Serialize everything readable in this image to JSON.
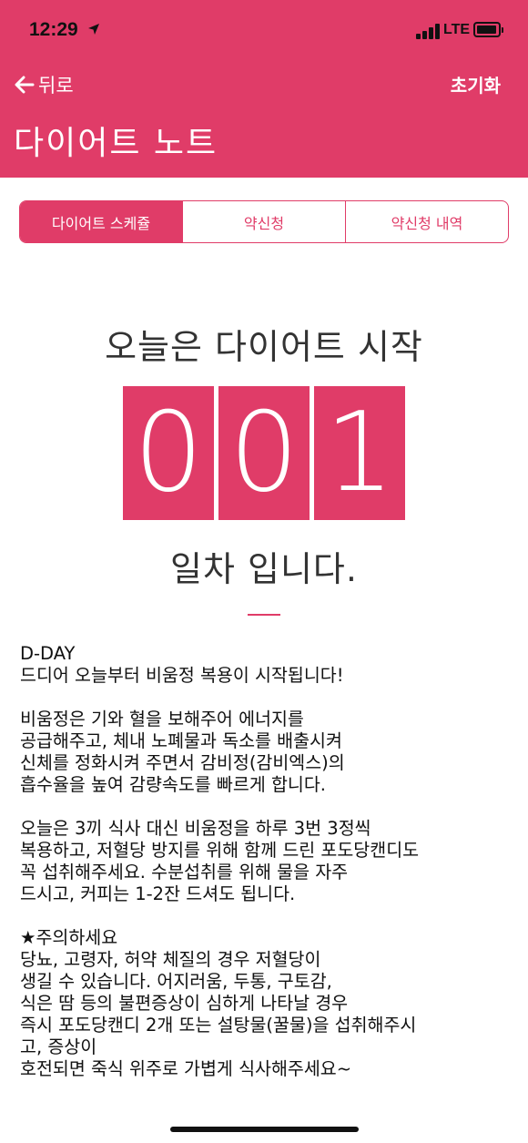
{
  "status_bar": {
    "time": "12:29",
    "network": "LTE",
    "icons": [
      "location-arrow-icon",
      "signal-bars-icon",
      "battery-icon"
    ]
  },
  "header": {
    "back_label": "뒤로",
    "reset_label": "초기화",
    "title": "다이어트 노트",
    "background_color": "#e03c68"
  },
  "tabs": [
    {
      "label": "다이어트 스케쥴",
      "active": true
    },
    {
      "label": "약신청",
      "active": false
    },
    {
      "label": "약신청 내역",
      "active": false
    }
  ],
  "main": {
    "headline": "오늘은 다이어트 시작",
    "day_digits": [
      "0",
      "0",
      "1"
    ],
    "subline": "일차 입니다."
  },
  "notes": {
    "day_title": "D-DAY",
    "intro": "드디어 오늘부터 비움정 복용이 시작됩니다!",
    "paragraph1": "비움정은 기와 혈을 보해주어 에너지를\n공급해주고, 체내 노폐물과 독소를 배출시켜\n신체를 정화시켜 주면서 감비정(감비엑스)의\n흡수율을 높여 감량속도를 빠르게 합니다.",
    "paragraph2": "오늘은 3끼 식사 대신 비움정을 하루 3번 3정씩\n복용하고, 저혈당 방지를 위해 함께 드린 포도당캔디도\n꼭 섭취해주세요. 수분섭취를 위해 물을 자주\n드시고, 커피는 1-2잔 드셔도 됩니다.",
    "caution_title": "★주의하세요",
    "caution_body": "당뇨, 고령자, 허약 체질의 경우 저혈당이\n생길 수 있습니다. 어지러움, 두통, 구토감,\n식은 땀 등의 불편증상이 심하게 나타날 경우\n즉시 포도당캔디 2개 또는 설탕물(꿀물)을 섭취해주시\n고, 증상이\n호전되면 죽식 위주로 가볍게 식사해주세요~"
  }
}
